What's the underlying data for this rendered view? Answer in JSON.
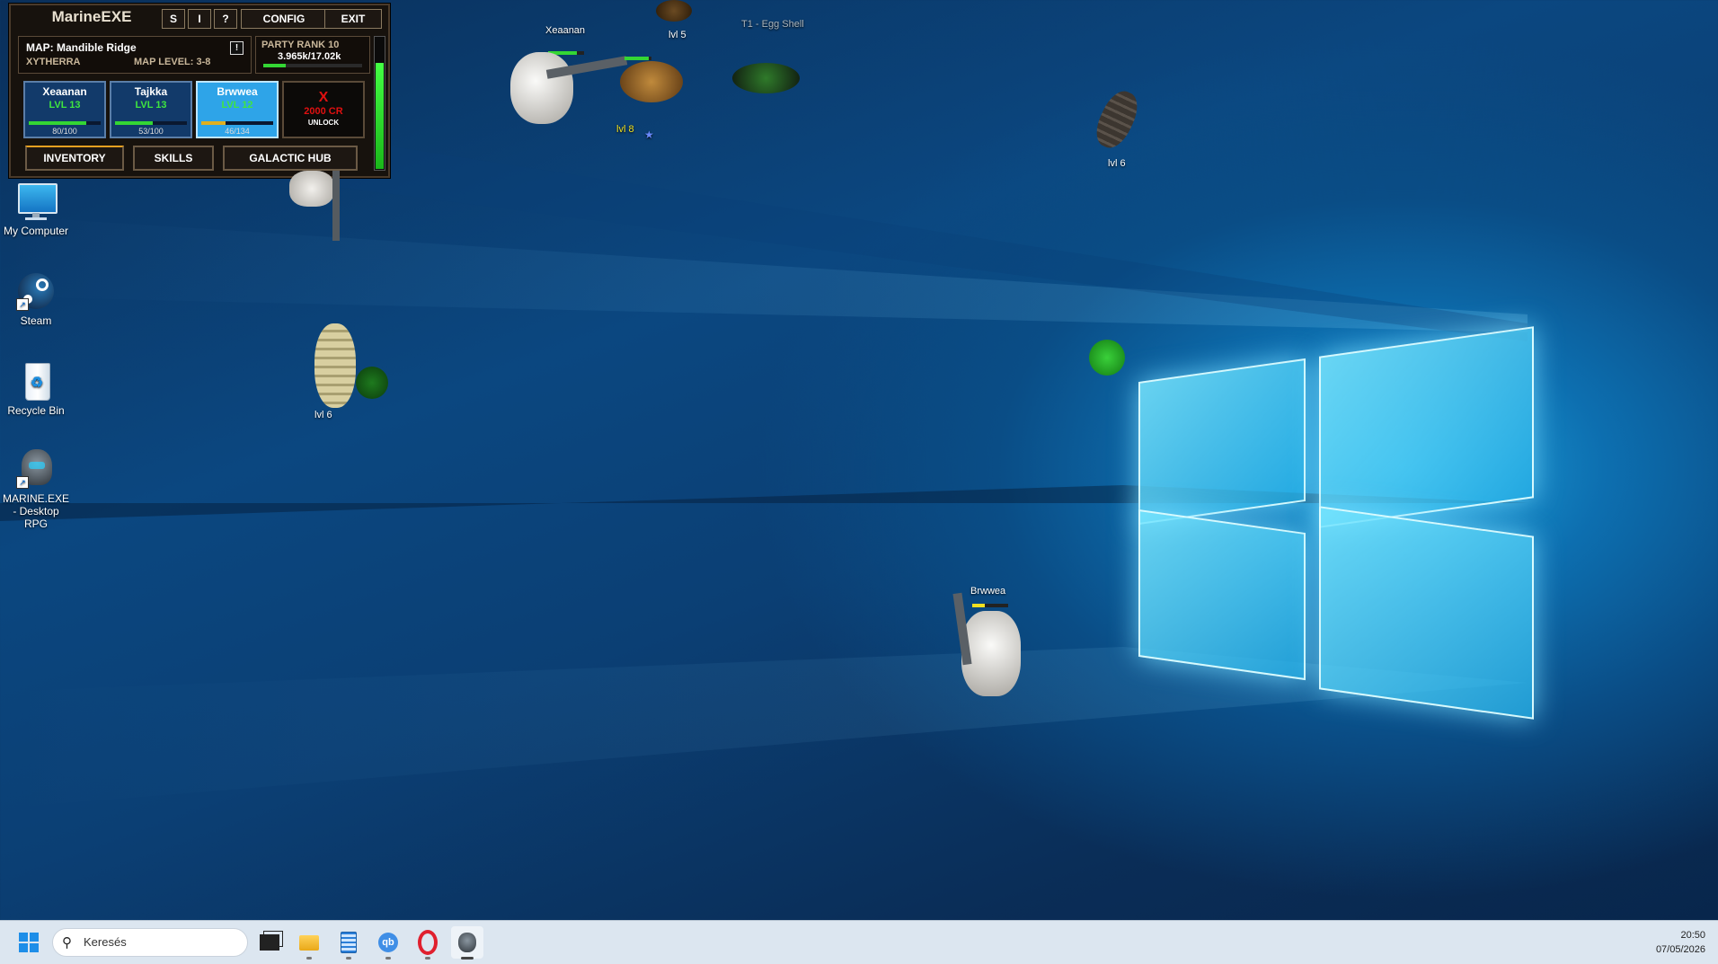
{
  "game": {
    "title": "MarineEXE",
    "title_buttons": [
      "S",
      "I",
      "?"
    ],
    "config_label": "CONFIG",
    "exit_label": "EXIT",
    "map_label": "MAP: Mandible Ridge",
    "map_alert": "!",
    "region": "XYTHERRA",
    "map_level": "MAP LEVEL: 3-8",
    "party_rank": "PARTY RANK 10",
    "party_xp": "3.965k/17.02k",
    "party_xp_progress": 0.23,
    "energy_level": 0.8,
    "characters": [
      {
        "name": "Xeaanan",
        "level": "LVL 13",
        "hp": "80/100",
        "hp_fraction": 0.8
      },
      {
        "name": "Tajkka",
        "level": "LVL 13",
        "hp": "53/100",
        "hp_fraction": 0.53
      },
      {
        "name": "Brwwea",
        "level": "LVL 12",
        "hp": "46/134",
        "hp_fraction": 0.34
      }
    ],
    "locked_slot": {
      "mark": "X",
      "price": "2000 CR",
      "action": "UNLOCK"
    },
    "nav": {
      "inventory": "INVENTORY",
      "skills": "SKILLS",
      "hub": "GALACTIC HUB"
    }
  },
  "world": {
    "players": [
      {
        "name": "Xeaanan"
      },
      {
        "name": "Brwwea"
      }
    ],
    "enemy_labels": {
      "top_spider": "lvl 8",
      "top_small": "lvl 5",
      "egg": "T1 - Egg Shell",
      "right_bug": "lvl 6",
      "left_bug": "lvl 6"
    }
  },
  "desktop": {
    "icons": [
      {
        "label": "My Computer",
        "icon": "monitor-icon"
      },
      {
        "label": "Steam",
        "icon": "steam-icon"
      },
      {
        "label": "Recycle Bin",
        "icon": "recycle-bin-icon"
      },
      {
        "label": "MARINE.EXE - Desktop RPG",
        "icon": "marine-exe-icon"
      }
    ]
  },
  "taskbar": {
    "search_placeholder": "Keresés",
    "time": "20:50",
    "date": "07/05/2026",
    "apps": [
      "task-view-icon",
      "file-explorer-icon",
      "notepad-icon",
      "qbittorrent-icon",
      "opera-icon",
      "marine-exe-icon"
    ]
  },
  "colors": {
    "accent_green": "#34d634",
    "rank_red": "#e01010",
    "level_yellow": "#f0e020"
  }
}
